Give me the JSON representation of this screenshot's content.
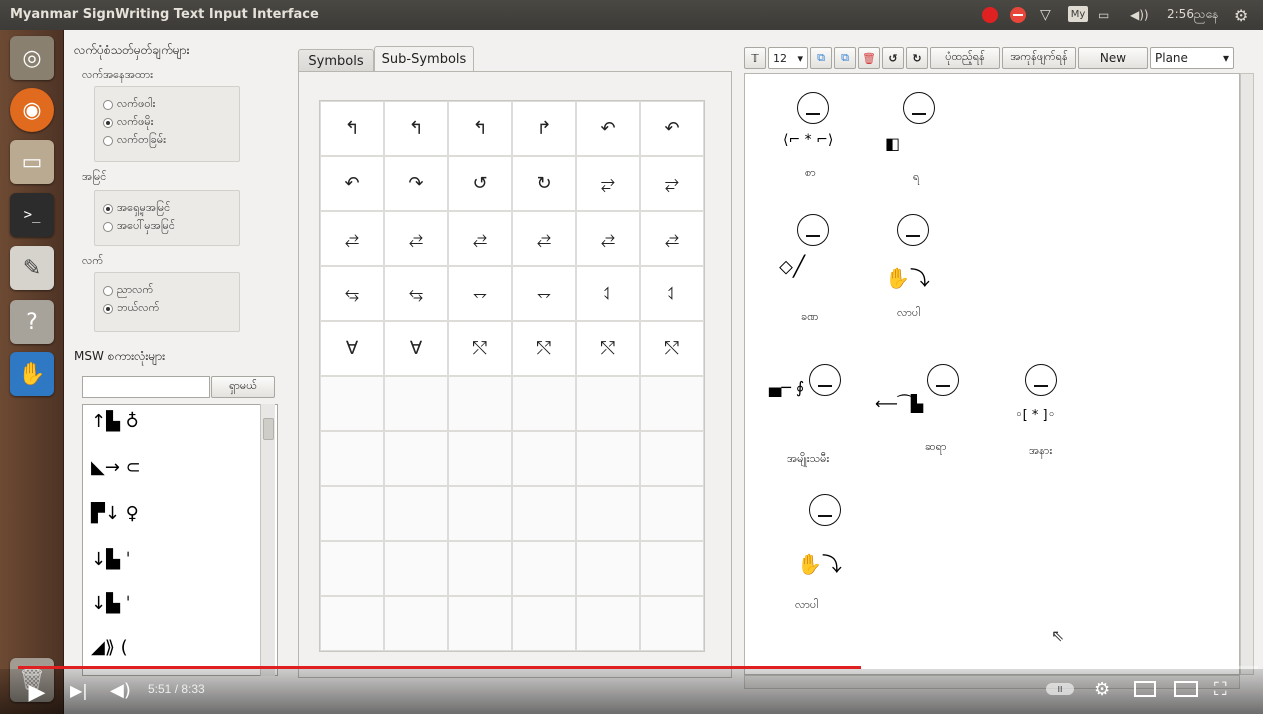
{
  "app_title": "Myanmar SignWriting Text Input Interface",
  "tray": {
    "record": "●",
    "stop": "",
    "wifi": "▽",
    "keyboard": "My",
    "battery": "▭",
    "volume": "◀))",
    "clock": "2:56ညနေ",
    "gear": "⚙"
  },
  "launcher": {
    "ubuntu": "◎",
    "firefox": "◉",
    "files": "▭",
    "terminal": ">_",
    "text_editor": "✎",
    "help": "?",
    "msw": "✋",
    "trash": "🗑"
  },
  "left_panel": {
    "title": "လက်ပုံစံသတ်မှတ်ချက်များ",
    "groups": [
      {
        "label": "လက်အနေအထား",
        "options": [
          "လက်ဖဝါး",
          "လက်ဖမိုး",
          "လက်တခြမ်း"
        ],
        "selected": 1
      },
      {
        "label": "အမြင်",
        "options": [
          "အရှေ့မှအမြင်",
          "အပေါ်မှအမြင်"
        ],
        "selected": 0
      },
      {
        "label": "လက်",
        "options": [
          "ညာလက်",
          "ဘယ်လက်"
        ],
        "selected": 1
      }
    ],
    "msw_title": "MSW စကားလုံးများ",
    "search_placeholder": "",
    "search_button": "ရှာမယ်",
    "word_items": [
      "↑▙ ♁",
      "◣→ ⊂",
      "▛↓ ♀",
      "↓▙ ˈ",
      "↓▙ ˈ",
      "◢⟫ ("
    ]
  },
  "tabs": [
    "Symbols",
    "Sub-Symbols"
  ],
  "active_tab": 1,
  "symbol_grid": [
    [
      "↰",
      "↰",
      "↰",
      "↱",
      "↶",
      "↶"
    ],
    [
      "↶",
      "↷",
      "↺",
      "↻",
      "⥂",
      "⥂"
    ],
    [
      "⥄",
      "⥄",
      "⥄",
      "⥄",
      "⥄",
      "⥄"
    ],
    [
      "⥃",
      "⥃",
      "⥐",
      "⥐",
      "⥑",
      "⥑"
    ],
    [
      "∀",
      "∀",
      "⤲",
      "⤲",
      "⤲",
      "⤲"
    ],
    [
      "",
      "",
      "",
      "",
      "",
      ""
    ],
    [
      "",
      "",
      "",
      "",
      "",
      ""
    ],
    [
      "",
      "",
      "",
      "",
      "",
      ""
    ],
    [
      "",
      "",
      "",
      "",
      "",
      ""
    ],
    [
      "",
      "",
      "",
      "",
      "",
      ""
    ]
  ],
  "toolbar": {
    "text_icon": "𝕋",
    "font_size": "12",
    "font_size_arrow": "▾",
    "copy_icon": "⧉",
    "paste_icon": "⧉",
    "delete_icon": "🗑",
    "undo_icon": "↺",
    "redo_icon": "↻",
    "btn_print": "ပုံထည့်ရန်",
    "btn_export": "အကုန်ဖျက်ရန်",
    "btn_new": "New",
    "plane_value": "Plane",
    "plane_arrow": "▾"
  },
  "canvas_signs": [
    {
      "glyph": "⟨⌐ * ⌐⟩",
      "label": "စာ"
    },
    {
      "glyph": "◧",
      "label": "ရ"
    },
    {
      "glyph": "⬦╱",
      "label": "ခဏ"
    },
    {
      "glyph": "✋⤵",
      "label": "လာပါ"
    },
    {
      "glyph": "▄─ ∮",
      "label": "အမျိုးသမီး"
    },
    {
      "glyph": "⟵⁀▙",
      "label": "ဆရာ"
    },
    {
      "glyph": "◦[ * ]◦",
      "label": "အနား"
    },
    {
      "glyph": "✋⤵",
      "label": "လာပါ"
    }
  ],
  "cursor": "⇖",
  "video": {
    "play": "▶",
    "next": "▶|",
    "volume": "◀)",
    "time": "5:51 / 8:33",
    "progress_fraction": 0.68,
    "autoplay": "II",
    "settings": "⚙",
    "fullscreen": "⛶"
  }
}
